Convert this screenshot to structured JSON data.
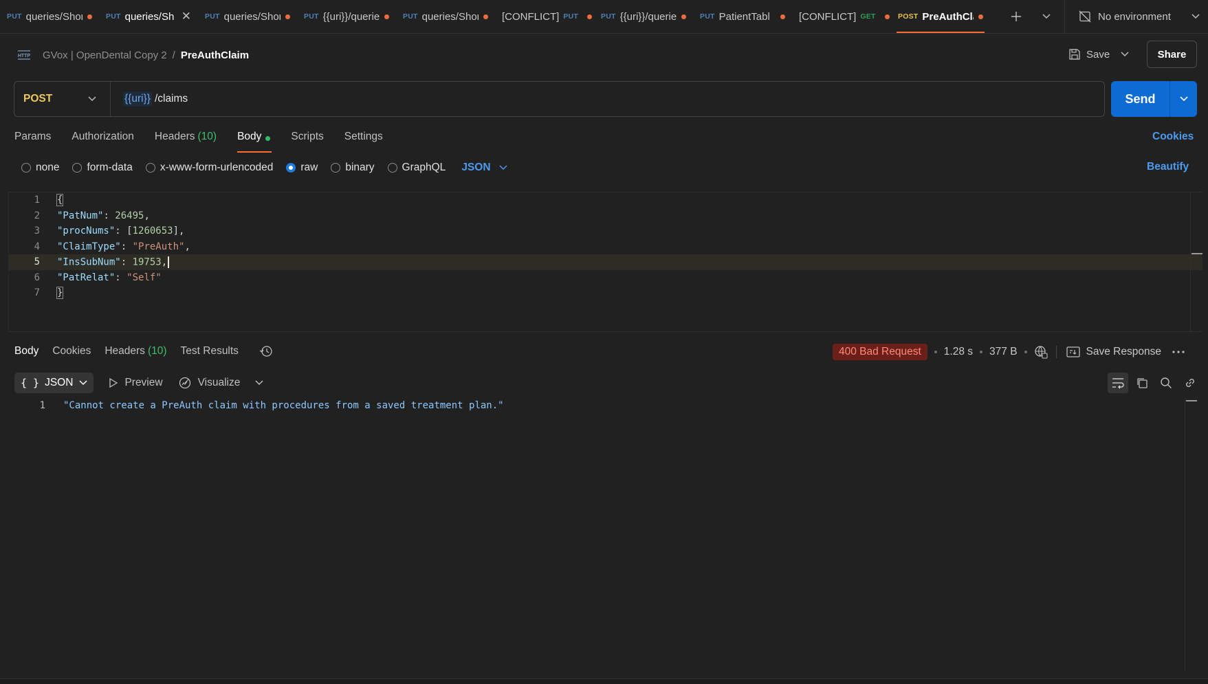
{
  "tabs": [
    {
      "method": "PUT",
      "title": "queries/Shor",
      "state": "dot",
      "method_class": "put"
    },
    {
      "method": "PUT",
      "title": "queries/Sh",
      "state": "close",
      "method_class": "put",
      "selected": true
    },
    {
      "method": "PUT",
      "title": "queries/Shor",
      "state": "dot",
      "method_class": "put"
    },
    {
      "method": "PUT",
      "title": "{{uri}}/querie",
      "state": "dot",
      "method_class": "put"
    },
    {
      "method": "PUT",
      "title": "queries/Shor",
      "state": "dot",
      "method_class": "put"
    },
    {
      "prefix": "[CONFLICT]",
      "method": "PUT",
      "title": "",
      "state": "dot",
      "method_class": "put"
    },
    {
      "method": "PUT",
      "title": "{{uri}}/querie",
      "state": "dot",
      "method_class": "put"
    },
    {
      "method": "PUT",
      "title": "PatientTabl",
      "state": "dot",
      "method_class": "put"
    },
    {
      "prefix": "[CONFLICT]",
      "method": "GET",
      "title": "",
      "state": "dot",
      "method_class": "get"
    },
    {
      "method": "POST",
      "title": "PreAuthClai",
      "state": "dot",
      "method_class": "post",
      "active": true
    }
  ],
  "environment": {
    "label": "No environment"
  },
  "breadcrumb": {
    "workspace": "GVox | OpenDental Copy 2",
    "separator": "/",
    "current": "PreAuthClaim"
  },
  "header_actions": {
    "save_label": "Save",
    "share_label": "Share"
  },
  "request": {
    "method": "POST",
    "url_variable": "{{uri}}",
    "url_path": "/claims",
    "send_label": "Send"
  },
  "request_tabs": [
    {
      "label": "Params"
    },
    {
      "label": "Authorization"
    },
    {
      "label": "Headers",
      "count": "(10)"
    },
    {
      "label": "Body",
      "active": true,
      "indicator": true
    },
    {
      "label": "Scripts"
    },
    {
      "label": "Settings"
    }
  ],
  "cookies_label": "Cookies",
  "body_types": [
    {
      "label": "none",
      "checked": false
    },
    {
      "label": "form-data",
      "checked": false
    },
    {
      "label": "x-www-form-urlencoded",
      "checked": false
    },
    {
      "label": "raw",
      "checked": true
    },
    {
      "label": "binary",
      "checked": false
    },
    {
      "label": "GraphQL",
      "checked": false
    }
  ],
  "body_language": "JSON",
  "beautify_label": "Beautify",
  "editor": {
    "current_line": 5,
    "lines": [
      {
        "num": "1",
        "tokens": [
          {
            "t": "{",
            "c": "brace"
          }
        ]
      },
      {
        "num": "2",
        "tokens": [
          {
            "t": "\"PatNum\"",
            "c": "k"
          },
          {
            "t": ": ",
            "c": ""
          },
          {
            "t": "26495",
            "c": "n"
          },
          {
            "t": ",",
            "c": ""
          }
        ]
      },
      {
        "num": "3",
        "tokens": [
          {
            "t": "\"procNums\"",
            "c": "k"
          },
          {
            "t": ": [",
            "c": ""
          },
          {
            "t": "1260653",
            "c": "n"
          },
          {
            "t": "],",
            "c": ""
          }
        ]
      },
      {
        "num": "4",
        "tokens": [
          {
            "t": "\"ClaimType\"",
            "c": "k"
          },
          {
            "t": ": ",
            "c": ""
          },
          {
            "t": "\"PreAuth\"",
            "c": "s"
          },
          {
            "t": ",",
            "c": ""
          }
        ]
      },
      {
        "num": "5",
        "tokens": [
          {
            "t": "\"InsSubNum\"",
            "c": "k"
          },
          {
            "t": ": ",
            "c": ""
          },
          {
            "t": "19753",
            "c": "n"
          },
          {
            "t": ",",
            "c": ""
          }
        ]
      },
      {
        "num": "6",
        "tokens": [
          {
            "t": "\"PatRelat\"",
            "c": "k"
          },
          {
            "t": ": ",
            "c": ""
          },
          {
            "t": "\"Self\"",
            "c": "s"
          }
        ]
      },
      {
        "num": "7",
        "tokens": [
          {
            "t": "}",
            "c": "brace"
          }
        ]
      }
    ]
  },
  "response_tabs": [
    {
      "label": "Body",
      "active": true
    },
    {
      "label": "Cookies"
    },
    {
      "label": "Headers",
      "count": "(10)"
    },
    {
      "label": "Test Results"
    }
  ],
  "response_status": {
    "code_text": "400 Bad Request",
    "time": "1.28 s",
    "size": "377 B",
    "save_label": "Save Response"
  },
  "response_toolbar": {
    "format": "JSON",
    "preview_label": "Preview",
    "visualize_label": "Visualize"
  },
  "response_body": {
    "line_num": "1",
    "text": "\"Cannot create a PreAuth claim with procedures from a saved treatment plan.\""
  },
  "colors": {
    "accent": "#ff6c37",
    "send": "#0c6cd4",
    "link": "#4b9bf0",
    "error_badge": "#6b1f1a"
  }
}
